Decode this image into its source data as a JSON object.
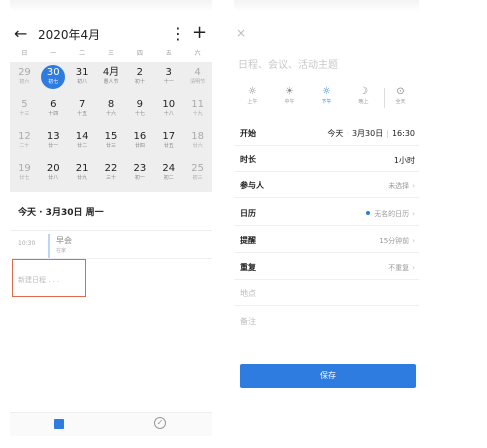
{
  "calendar": {
    "title": "2020年4月",
    "weekdays": [
      "日",
      "一",
      "二",
      "三",
      "四",
      "五",
      "六"
    ],
    "weeks": [
      [
        {
          "d": "29",
          "l": "初六",
          "dim": true
        },
        {
          "d": "30",
          "l": "初七",
          "sel": true
        },
        {
          "d": "31",
          "l": "初八"
        },
        {
          "d": "4月",
          "l": "愚人节"
        },
        {
          "d": "2",
          "l": "初十"
        },
        {
          "d": "3",
          "l": "十一"
        },
        {
          "d": "4",
          "l": "清明节",
          "dim": true
        }
      ],
      [
        {
          "d": "5",
          "l": "十三",
          "dim": true
        },
        {
          "d": "6",
          "l": "十四"
        },
        {
          "d": "7",
          "l": "十五"
        },
        {
          "d": "8",
          "l": "十六"
        },
        {
          "d": "9",
          "l": "十七"
        },
        {
          "d": "10",
          "l": "十八"
        },
        {
          "d": "11",
          "l": "十九",
          "dim": true
        }
      ],
      [
        {
          "d": "12",
          "l": "二十",
          "dim": true
        },
        {
          "d": "13",
          "l": "廿一"
        },
        {
          "d": "14",
          "l": "廿二"
        },
        {
          "d": "15",
          "l": "廿三"
        },
        {
          "d": "16",
          "l": "廿四"
        },
        {
          "d": "17",
          "l": "廿五"
        },
        {
          "d": "18",
          "l": "廿六",
          "dim": true
        }
      ],
      [
        {
          "d": "19",
          "l": "廿七",
          "dim": true
        },
        {
          "d": "20",
          "l": "廿八"
        },
        {
          "d": "21",
          "l": "廿九"
        },
        {
          "d": "22",
          "l": "三十"
        },
        {
          "d": "23",
          "l": "初一"
        },
        {
          "d": "24",
          "l": "初二"
        },
        {
          "d": "25",
          "l": "初三",
          "dim": true
        }
      ]
    ]
  },
  "day": {
    "label": "今天 · 3月30日 周一"
  },
  "event": {
    "time": "10:30",
    "title": "早会",
    "sub": "在家"
  },
  "new_event_placeholder": "新建日程 . . .",
  "editor": {
    "close": "×",
    "subject_placeholder": "日程、会议、活动主题",
    "time_options": [
      {
        "icon": "☼",
        "label": "上午"
      },
      {
        "icon": "☀",
        "label": "中午"
      },
      {
        "icon": "☼",
        "label": "下午",
        "on": true
      },
      {
        "icon": "☽",
        "label": "晚上"
      },
      {
        "icon": "⊙",
        "label": "全天"
      }
    ],
    "start_label": "开始",
    "start_value": "今天",
    "start_date": "3月30日",
    "start_time": "16:30",
    "duration_label": "时长",
    "duration_value": "1小时",
    "participants_label": "参与人",
    "participants_value": "未选择",
    "calendar_label": "日历",
    "calendar_value": "无名的日历",
    "remind_label": "提醒",
    "remind_value": "15分钟前",
    "repeat_label": "重复",
    "repeat_value": "不重复",
    "location_label": "地点",
    "notes_label": "备注",
    "save_label": "保存"
  },
  "colors": {
    "accent": "#2e7ce0",
    "highlight": "#e06a50"
  }
}
